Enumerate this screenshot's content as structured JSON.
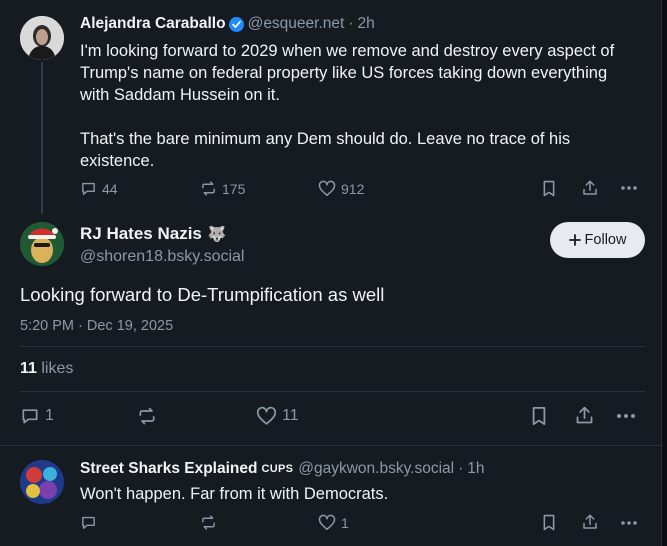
{
  "parent_post": {
    "author_name": "Alejandra Caraballo",
    "handle": "@esqueer.net",
    "separator": "·",
    "time": "2h",
    "paragraphs": [
      "I'm looking forward to 2029 when we remove and destroy every aspect of Trump's name on federal property like US forces taking down everything with Saddam Hussein on it.",
      "That's the bare minimum any Dem should do. Leave no trace of his existence."
    ],
    "reply_count": "44",
    "repost_count": "175",
    "like_count": "912"
  },
  "focused_post": {
    "author_name": "RJ Hates Nazis",
    "name_emoji": "🐺",
    "handle": "@shoren18.bsky.social",
    "follow_label": "Follow",
    "text": "Looking forward to De-Trumpification as well",
    "timestamp": "5:20 PM · Dec 19, 2025",
    "likes_count": "11",
    "likes_word": "likes",
    "reply_count": "1",
    "like_count": "11"
  },
  "reply_post": {
    "author_name": "Street Sharks Explained",
    "name_suffix": "CUPS",
    "handle": "@gaykwon.bsky.social",
    "separator": "·",
    "time": "1h",
    "text": "Won't happen. Far from it with Democrats.",
    "like_count": "1"
  },
  "colors": {
    "background": "#161b22",
    "muted_text": "#8b98a5",
    "verified_blue": "#208bfe",
    "follow_button_bg": "#e7ebef"
  }
}
